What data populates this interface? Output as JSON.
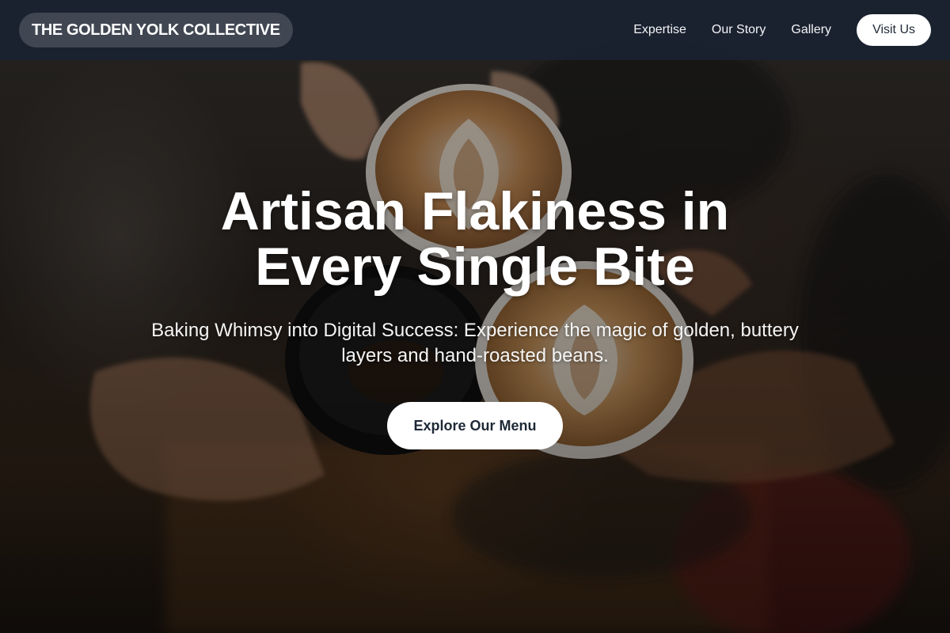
{
  "header": {
    "brand": "THE GOLDEN YOLK COLLECTIVE",
    "nav": {
      "expertise": "Expertise",
      "story": "Our Story",
      "gallery": "Gallery"
    },
    "cta": "Visit Us"
  },
  "hero": {
    "title_line1": "Artisan Flakiness in",
    "title_line2": "Every Single Bite",
    "subtitle_line1": "Baking Whimsy into Digital Success: Experience the magic of golden, buttery",
    "subtitle_line2": "layers and hand-roasted beans.",
    "cta": "Explore Our Menu",
    "background_image": "coffee-cups-cheers-photo"
  },
  "colors": {
    "header_bg": "#1a2232",
    "button_bg": "#ffffff",
    "button_text": "#1f2937",
    "hero_text": "#ffffff"
  }
}
